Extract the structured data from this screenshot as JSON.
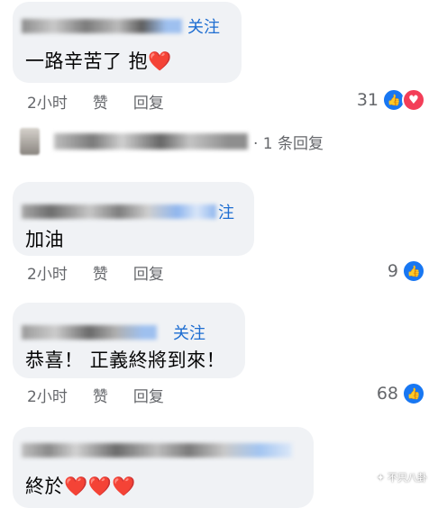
{
  "comments": [
    {
      "name_action": "关注",
      "text": "一路辛苦了 抱",
      "heart": "❤️",
      "time": "2小时",
      "like": "赞",
      "reply": "回复",
      "count": "31",
      "reactions": [
        "like",
        "love"
      ]
    },
    {
      "name_action": "注",
      "text": "加油",
      "time": "2小时",
      "like": "赞",
      "reply": "回复",
      "count": "9",
      "reactions": [
        "like"
      ]
    },
    {
      "name_action": "关注",
      "text": "恭喜！ 正義終將到來！",
      "time": "2小时",
      "like": "赞",
      "reply": "回复",
      "count": "68",
      "reactions": [
        "like"
      ]
    },
    {
      "text": "終於",
      "hearts": "❤️❤️❤️"
    }
  ],
  "reply_summary": "· 1 条回复",
  "watermark": "不只八卦",
  "colors": {
    "bubble": "#f0f2f5",
    "link": "#1d6dd1",
    "like": "#1877f2",
    "love": "#f33e58",
    "meta": "#65676b"
  }
}
